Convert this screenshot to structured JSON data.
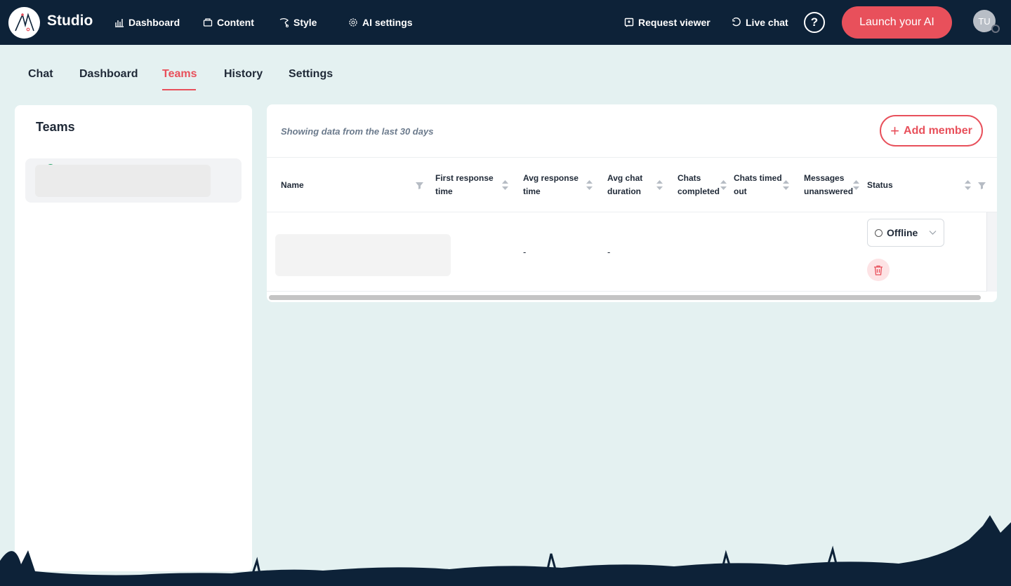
{
  "app": {
    "brand": "Studio"
  },
  "topnav": {
    "items": [
      {
        "label": "Dashboard",
        "icon": "bar-chart-icon"
      },
      {
        "label": "Content",
        "icon": "content-icon"
      },
      {
        "label": "Style",
        "icon": "style-icon"
      },
      {
        "label": "AI settings",
        "icon": "ai-settings-icon"
      }
    ],
    "right_items": [
      {
        "label": "Request viewer",
        "icon": "request-viewer-icon"
      },
      {
        "label": "Live chat",
        "icon": "live-chat-icon"
      }
    ],
    "help": "?",
    "launch_label": "Launch your AI",
    "avatar_initials": "TU"
  },
  "tabs": {
    "items": [
      "Chat",
      "Dashboard",
      "Teams",
      "History",
      "Settings"
    ],
    "active": "Teams"
  },
  "left_panel": {
    "title": "Teams"
  },
  "right_panel": {
    "range_note": "Showing data from the last 30 days",
    "add_member_label": "Add member",
    "columns": [
      {
        "line1": "Name",
        "line2": ""
      },
      {
        "line1": "First response",
        "line2": "time"
      },
      {
        "line1": "Avg response",
        "line2": "time"
      },
      {
        "line1": "Avg chat",
        "line2": "duration"
      },
      {
        "line1": "Chats",
        "line2": "completed"
      },
      {
        "line1": "Chats timed",
        "line2": "out"
      },
      {
        "line1": "Messages",
        "line2": "unanswered"
      },
      {
        "line1": "Status",
        "line2": ""
      }
    ],
    "rows": [
      {
        "name": "",
        "first_response": "",
        "avg_response": "-",
        "avg_chat_duration": "-",
        "chats_completed": "",
        "chats_timed_out": "",
        "messages_unanswered": "",
        "status": "Offline"
      }
    ]
  },
  "colors": {
    "navbar": "#0d2238",
    "accent": "#e8505b",
    "background": "#e4f1f1"
  }
}
